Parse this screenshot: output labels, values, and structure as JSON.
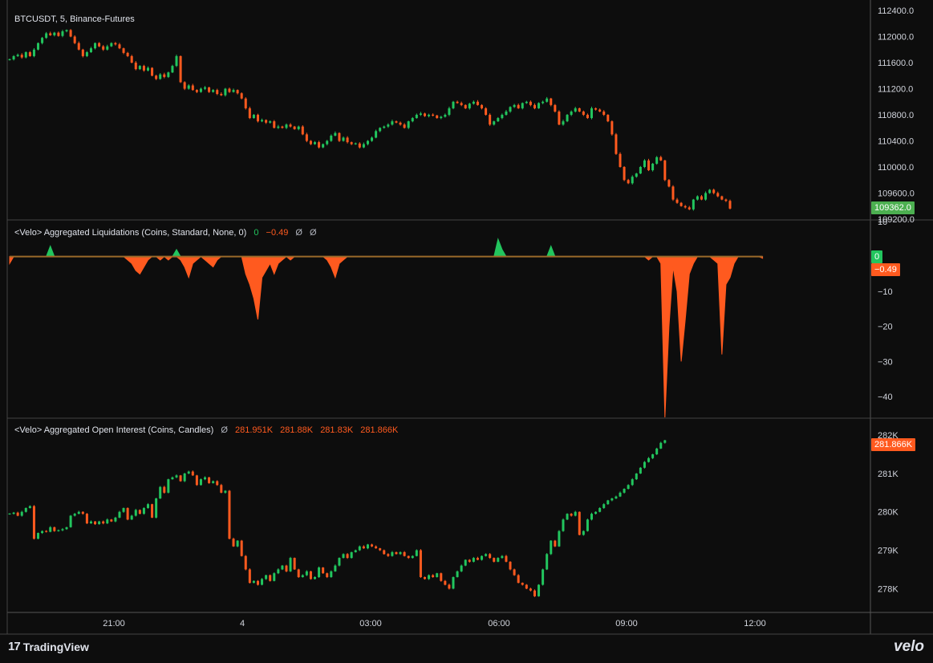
{
  "panes": {
    "price_title": "BTCUSDT, 5, Binance-Futures",
    "liq_title": "<Velo> Aggregated Liquidations (Coins, Standard, None, 0)",
    "liq_v1": "0",
    "liq_v2": "−0.49",
    "liq_v3": "Ø",
    "liq_v4": "Ø",
    "oi_title": "<Velo> Aggregated Open Interest (Coins, Candles)",
    "oi_sym": "Ø",
    "oi_o": "281.951K",
    "oi_h": "281.88K",
    "oi_l": "281.83K",
    "oi_c": "281.866K"
  },
  "tags": {
    "price": "109362.0",
    "liq_zero": "0",
    "liq_value": "−0.49",
    "oi": "281.866K"
  },
  "footer": {
    "brand": "TradingView",
    "velo": "velo"
  },
  "colors": {
    "background": "#0d0d0d",
    "up": "#22c55e",
    "down": "#ff5a1f",
    "axis_text": "#d1d4dc",
    "price_tag": "#4caf50",
    "oi_tag": "#ff5a1f"
  },
  "chart_data": [
    {
      "type": "candlestick",
      "title": "BTCUSDT, 5, Binance-Futures",
      "ylim": [
        109200,
        112450
      ],
      "yticks": [
        "112400.0",
        "112000.0",
        "111600.0",
        "111200.0",
        "110800.0",
        "110400.0",
        "110000.0",
        "109600.0",
        "109200.0"
      ],
      "xticks": [
        "21:00",
        "4",
        "03:00",
        "06:00",
        "09:00",
        "12:00"
      ],
      "closes": [
        111650,
        111700,
        111720,
        111680,
        111760,
        111700,
        111800,
        111900,
        111980,
        112050,
        112020,
        112060,
        112010,
        112080,
        112100,
        112000,
        111900,
        111800,
        111700,
        111760,
        111820,
        111900,
        111850,
        111800,
        111850,
        111900,
        111880,
        111820,
        111750,
        111700,
        111600,
        111500,
        111550,
        111480,
        111520,
        111400,
        111350,
        111420,
        111380,
        111450,
        111550,
        111700,
        111300,
        111200,
        111250,
        111180,
        111150,
        111200,
        111220,
        111150,
        111180,
        111120,
        111100,
        111200,
        111150,
        111180,
        111130,
        111050,
        110900,
        110750,
        110800,
        110700,
        110720,
        110680,
        110700,
        110600,
        110620,
        110600,
        110650,
        110620,
        110580,
        110620,
        110500,
        110400,
        110350,
        110380,
        110300,
        110350,
        110400,
        110480,
        110520,
        110400,
        110450,
        110380,
        110350,
        110360,
        110300,
        110350,
        110400,
        110450,
        110550,
        110600,
        110620,
        110650,
        110700,
        110680,
        110650,
        110600,
        110700,
        110750,
        110800,
        110820,
        110780,
        110800,
        110790,
        110750,
        110770,
        110800,
        110900,
        111000,
        110980,
        110950,
        110900,
        110970,
        111000,
        110950,
        110900,
        110800,
        110650,
        110700,
        110750,
        110800,
        110850,
        110920,
        110950,
        110900,
        110980,
        111000,
        110950,
        110900,
        110980,
        111000,
        111050,
        110950,
        110850,
        110650,
        110700,
        110800,
        110850,
        110900,
        110850,
        110800,
        110750,
        110900,
        110880,
        110850,
        110800,
        110700,
        110500,
        110200,
        110000,
        109800,
        109750,
        109850,
        109900,
        110000,
        110100,
        109950,
        110050,
        110150,
        110100,
        109800,
        109700,
        109500,
        109450,
        109400,
        109380,
        109350,
        109500,
        109550,
        109500,
        109600,
        109650,
        109600,
        109550,
        109500,
        109480,
        109362
      ],
      "colors": {
        "up": "#22c55e",
        "down": "#ff5a1f"
      }
    },
    {
      "type": "area",
      "title": "<Velo> Aggregated Liquidations (Coins, Standard, None, 0)",
      "ylim": [
        -46,
        10
      ],
      "yticks": [
        "10",
        "−10",
        "−20",
        "−30",
        "−40"
      ],
      "values": [
        -2,
        0,
        0,
        0,
        0,
        0,
        0,
        0,
        0,
        0,
        3,
        0,
        0,
        0,
        0,
        0,
        0,
        0,
        0,
        0,
        0,
        0,
        0,
        0,
        0,
        0,
        0,
        0,
        0,
        -1,
        -2,
        -4,
        -5,
        -3,
        -1,
        0,
        0,
        -1,
        0,
        -1,
        0,
        2,
        -1,
        -3,
        -6,
        -2,
        -1,
        0,
        -1,
        -2,
        -3,
        -1,
        0,
        0,
        0,
        0,
        0,
        0,
        -5,
        -8,
        -12,
        -18,
        -6,
        -4,
        -2,
        -5,
        -2,
        -1,
        0,
        -1,
        0,
        0,
        0,
        0,
        0,
        0,
        0,
        0,
        -1,
        -3,
        -6,
        -2,
        -1,
        0,
        0,
        0,
        0,
        0,
        0,
        0,
        0,
        0,
        0,
        0,
        0,
        0,
        0,
        0,
        0,
        0,
        0,
        0,
        0,
        0,
        0,
        0,
        0,
        0,
        0,
        0,
        0,
        0,
        0,
        0,
        0,
        0,
        0,
        0,
        0,
        0,
        5,
        2,
        0,
        0,
        0,
        0,
        0,
        0,
        0,
        0,
        0,
        0,
        0,
        3,
        0,
        0,
        0,
        0,
        0,
        0,
        0,
        0,
        0,
        0,
        0,
        0,
        0,
        0,
        0,
        0,
        0,
        0,
        0,
        0,
        0,
        0,
        0,
        -1,
        0,
        0,
        -2,
        -46,
        -20,
        -3,
        -10,
        -30,
        -18,
        -5,
        -2,
        0,
        0,
        0,
        0,
        -1,
        -2,
        -28,
        -8,
        -6,
        -2,
        0,
        0,
        0,
        0,
        0,
        0,
        -0.49
      ],
      "colors": {
        "up": "#22c55e",
        "down": "#ff5a1f"
      }
    },
    {
      "type": "candlestick",
      "title": "<Velo> Aggregated Open Interest (Coins, Candles)",
      "ylim": [
        277400,
        282400
      ],
      "yticks": [
        "282K",
        "281K",
        "280K",
        "279K",
        "278K"
      ],
      "closes": [
        279950,
        279980,
        279900,
        280000,
        280100,
        280150,
        279300,
        279450,
        279500,
        279480,
        279600,
        279500,
        279520,
        279550,
        279600,
        279900,
        279950,
        280000,
        279950,
        279700,
        279750,
        279680,
        279750,
        279700,
        279800,
        279750,
        279850,
        280000,
        280100,
        279800,
        279900,
        280050,
        279950,
        280100,
        280200,
        279850,
        280350,
        280650,
        280500,
        280850,
        280900,
        280950,
        280800,
        281000,
        281050,
        280950,
        280700,
        280850,
        280900,
        280750,
        280800,
        280700,
        280500,
        280550,
        279300,
        279100,
        279250,
        278850,
        278500,
        278150,
        278200,
        278100,
        278250,
        278350,
        278200,
        278400,
        278500,
        278600,
        278450,
        278800,
        278500,
        278300,
        278350,
        278450,
        278250,
        278300,
        278550,
        278400,
        278300,
        278450,
        278600,
        278800,
        278900,
        278800,
        278950,
        279000,
        279100,
        279050,
        279150,
        279100,
        279050,
        279000,
        278900,
        278850,
        278950,
        278900,
        278950,
        278850,
        278800,
        278850,
        279000,
        278300,
        278250,
        278350,
        278300,
        278400,
        278200,
        278100,
        278000,
        278300,
        278450,
        278600,
        278750,
        278700,
        278800,
        278750,
        278850,
        278900,
        278800,
        278700,
        278800,
        278850,
        278700,
        278500,
        278350,
        278150,
        278100,
        278000,
        277950,
        277800,
        278100,
        278500,
        278900,
        279250,
        279100,
        279500,
        279800,
        279950,
        279900,
        280000,
        279400,
        279500,
        279800,
        279950,
        280000,
        280100,
        280200,
        280300,
        280350,
        280400,
        280500,
        280600,
        280700,
        280850,
        281000,
        281150,
        281300,
        281400,
        281500,
        281650,
        281800,
        281866
      ],
      "colors": {
        "up": "#22c55e",
        "down": "#ff5a1f"
      }
    }
  ]
}
